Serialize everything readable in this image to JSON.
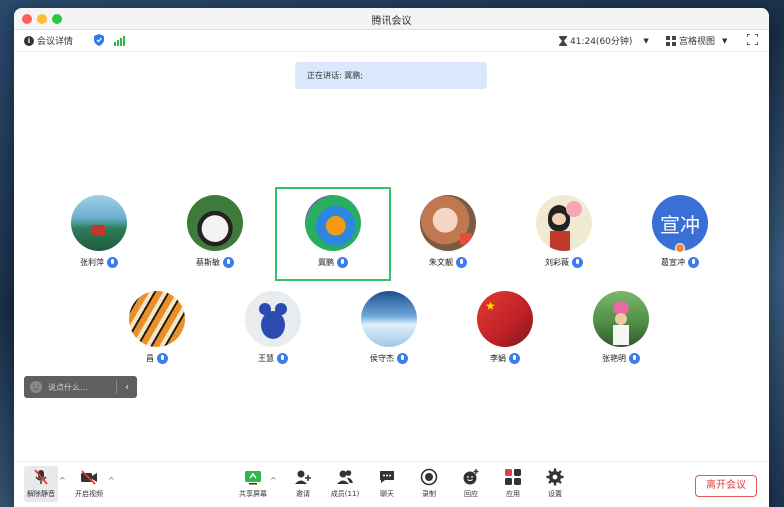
{
  "window": {
    "title": "腾讯会议"
  },
  "toolbar": {
    "meeting_info_label": "会议详情",
    "timer": "41:24(60分钟)",
    "view_label": "宫格视图"
  },
  "speaking": {
    "text": "正在讲话: 冀鹏;"
  },
  "participants": [
    {
      "name": "张利萍"
    },
    {
      "name": "蔡斯敏"
    },
    {
      "name": "冀鹏"
    },
    {
      "name": "朱文靓"
    },
    {
      "name": "刘彩薇"
    },
    {
      "name": "葛宣冲",
      "avatar_text": "宣冲"
    },
    {
      "name": "昌"
    },
    {
      "name": "王慧"
    },
    {
      "name": "侯守杰"
    },
    {
      "name": "李娟"
    },
    {
      "name": "张艳明"
    }
  ],
  "chat": {
    "placeholder": "说点什么..."
  },
  "bottom": {
    "unmute": "解除静音",
    "start_video": "开启视频",
    "share_screen": "共享屏幕",
    "invite": "邀请",
    "members": "成员(11)",
    "chat": "聊天",
    "record": "录制",
    "reactions": "回应",
    "apps": "应用",
    "settings": "设置",
    "leave": "离开会议"
  },
  "colors": {
    "accent": "#3a7df0",
    "active_border": "#2fc36a",
    "leave": "#e04040"
  }
}
